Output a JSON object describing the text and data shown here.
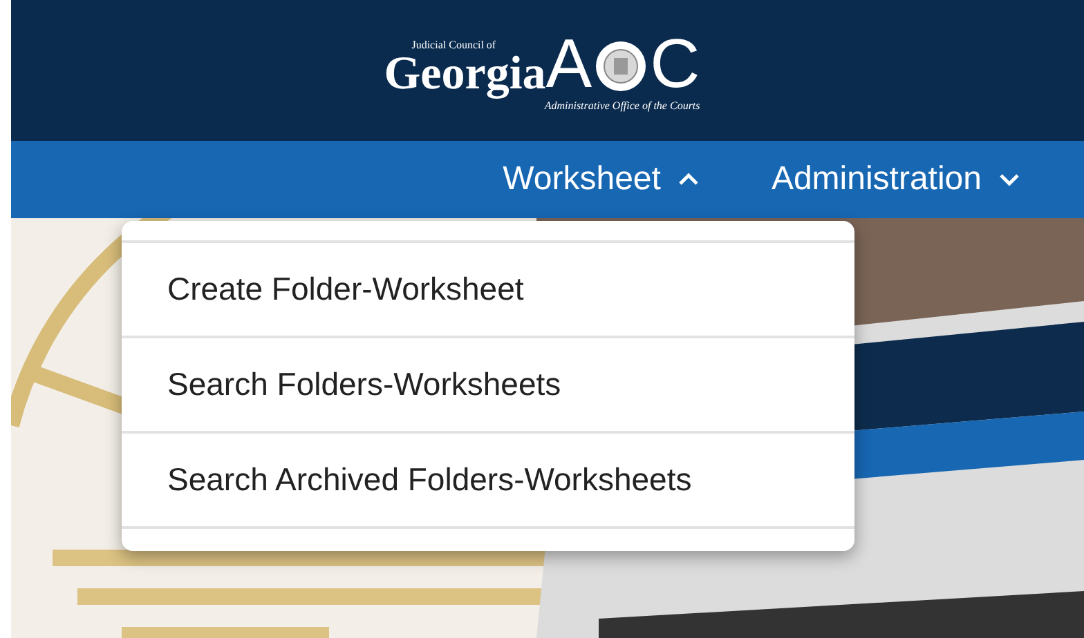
{
  "logo": {
    "top_line": "Judicial Council of",
    "name": "Georgia",
    "letter_left": "A",
    "letter_right": "C",
    "subtitle": "Administrative Office of the Courts"
  },
  "nav": [
    {
      "label": "Worksheet",
      "expanded": true
    },
    {
      "label": "Administration",
      "expanded": false
    }
  ],
  "menu": [
    {
      "label": "Create Folder-Worksheet"
    },
    {
      "label": "Search Folders-Worksheets"
    },
    {
      "label": "Search Archived Folders-Worksheets"
    }
  ]
}
